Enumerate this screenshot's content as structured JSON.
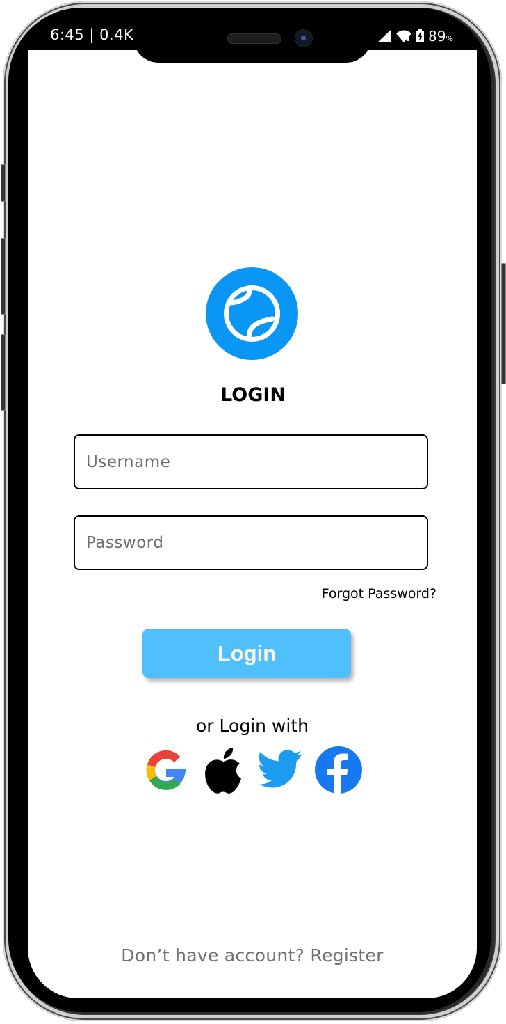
{
  "status_bar": {
    "time": "6:45 | 0.4K",
    "battery": "89",
    "battery_unit": "%"
  },
  "app": {
    "logo_icon": "tennis-ball-icon",
    "title": "LOGIN"
  },
  "form": {
    "username_placeholder": "Username",
    "password_placeholder": "Password",
    "forgot_password": "Forgot Password?",
    "login_button": "Login"
  },
  "social": {
    "label": "or Login with",
    "providers": [
      "google-icon",
      "apple-icon",
      "twitter-icon",
      "facebook-icon"
    ]
  },
  "footer": {
    "prompt": "Don’t have account?",
    "register_link": "Register"
  },
  "colors": {
    "accent": "#4fc0fb",
    "logo_blue": "#0a96f5",
    "placeholder_gray": "#6e6e6e"
  }
}
